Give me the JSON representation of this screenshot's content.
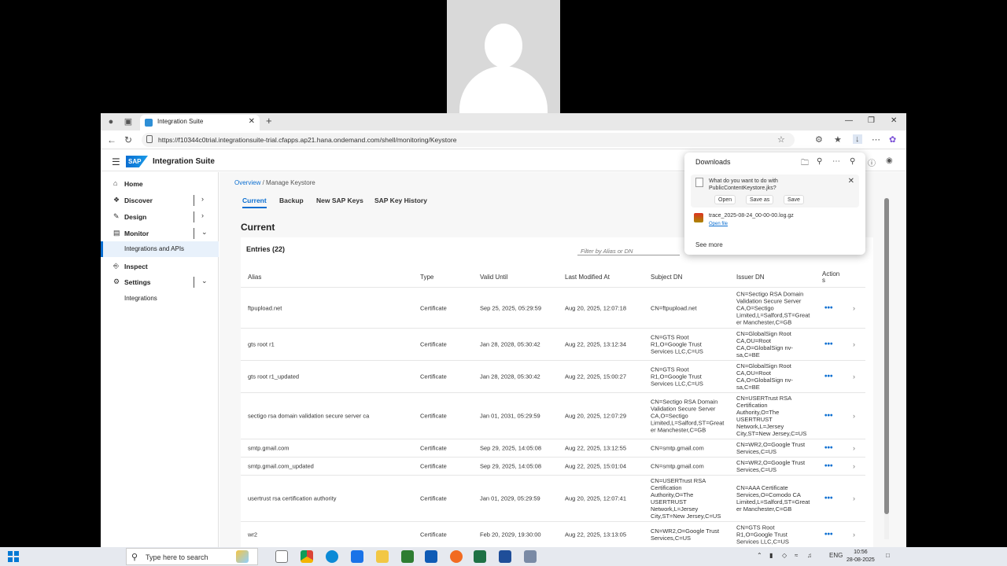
{
  "browser": {
    "tab_title": "Integration Suite",
    "url": "https://f10344c0trial.integrationsuite-trial.cfapps.ap21.hana.ondemand.com/shell/monitoring/Keystore"
  },
  "shell": {
    "logo": "SAP",
    "app_title": "Integration Suite"
  },
  "sidenav": {
    "items": [
      {
        "label": "Home"
      },
      {
        "label": "Discover"
      },
      {
        "label": "Design"
      },
      {
        "label": "Monitor"
      },
      {
        "label": "Integrations and APIs"
      },
      {
        "label": "Inspect"
      },
      {
        "label": "Settings"
      },
      {
        "label": "Integrations"
      }
    ]
  },
  "breadcrumb": {
    "overview": "Overview",
    "separator": "/",
    "current": "Manage Keystore"
  },
  "tabs": [
    "Current",
    "Backup",
    "New SAP Keys",
    "SAP Key History"
  ],
  "section_title": "Current",
  "entries_label": "Entries (22)",
  "filter_placeholder": "Filter by Alias or DN",
  "columns": [
    "Alias",
    "Type",
    "Valid Until",
    "Last Modified At",
    "Subject DN",
    "Issuer DN",
    "Action",
    "s"
  ],
  "rows": [
    {
      "alias": "ftpupload.net",
      "type": "Certificate",
      "valid": "Sep 25, 2025, 05:29:59",
      "modified": "Aug 20, 2025, 12:07:18",
      "subject": [
        "CN=ftpupload.net"
      ],
      "issuer": [
        "CN=Sectigo RSA Domain",
        "Validation Secure Server",
        "CA,O=Sectigo",
        "Limited,L=Salford,ST=Great",
        "er Manchester,C=GB"
      ]
    },
    {
      "alias": "gts root r1",
      "type": "Certificate",
      "valid": "Jan 28, 2028, 05:30:42",
      "modified": "Aug 22, 2025, 13:12:34",
      "subject": [
        "CN=GTS Root",
        "R1,O=Google Trust",
        "Services LLC,C=US"
      ],
      "issuer": [
        "CN=GlobalSign Root",
        "CA,OU=Root",
        "CA,O=GlobalSign nv-",
        "sa,C=BE"
      ]
    },
    {
      "alias": "gts root r1_updated",
      "type": "Certificate",
      "valid": "Jan 28, 2028, 05:30:42",
      "modified": "Aug 22, 2025, 15:00:27",
      "subject": [
        "CN=GTS Root",
        "R1,O=Google Trust",
        "Services LLC,C=US"
      ],
      "issuer": [
        "CN=GlobalSign Root",
        "CA,OU=Root",
        "CA,O=GlobalSign nv-",
        "sa,C=BE"
      ]
    },
    {
      "alias": "sectigo rsa domain validation secure server ca",
      "type": "Certificate",
      "valid": "Jan 01, 2031, 05:29:59",
      "modified": "Aug 20, 2025, 12:07:29",
      "subject": [
        "CN=Sectigo RSA Domain",
        "Validation Secure Server",
        "CA,O=Sectigo",
        "Limited,L=Salford,ST=Great",
        "er Manchester,C=GB"
      ],
      "issuer": [
        "CN=USERTrust RSA",
        "Certification",
        "Authority,O=The",
        "USERTRUST",
        "Network,L=Jersey",
        "City,ST=New Jersey,C=US"
      ]
    },
    {
      "alias": "smtp.gmail.com",
      "type": "Certificate",
      "valid": "Sep 29, 2025, 14:05:08",
      "modified": "Aug 22, 2025, 13:12:55",
      "subject": [
        "CN=smtp.gmail.com"
      ],
      "issuer": [
        "CN=WR2,O=Google Trust",
        "Services,C=US"
      ]
    },
    {
      "alias": "smtp.gmail.com_updated",
      "type": "Certificate",
      "valid": "Sep 29, 2025, 14:05:08",
      "modified": "Aug 22, 2025, 15:01:04",
      "subject": [
        "CN=smtp.gmail.com"
      ],
      "issuer": [
        "CN=WR2,O=Google Trust",
        "Services,C=US"
      ]
    },
    {
      "alias": "usertrust rsa certification authority",
      "type": "Certificate",
      "valid": "Jan 01, 2029, 05:29:59",
      "modified": "Aug 20, 2025, 12:07:41",
      "subject": [
        "CN=USERTrust RSA",
        "Certification",
        "Authority,O=The",
        "USERTRUST",
        "Network,L=Jersey",
        "City,ST=New Jersey,C=US"
      ],
      "issuer": [
        "CN=AAA Certificate",
        "Services,O=Comodo CA",
        "Limited,L=Salford,ST=Great",
        "er Manchester,C=GB"
      ]
    },
    {
      "alias": "wr2",
      "type": "Certificate",
      "valid": "Feb 20, 2029, 19:30:00",
      "modified": "Aug 22, 2025, 13:13:05",
      "subject": [
        "CN=WR2,O=Google Trust",
        "Services,C=US"
      ],
      "issuer": [
        "CN=GTS Root",
        "R1,O=Google Trust",
        "Services LLC,C=US"
      ]
    }
  ],
  "downloads": {
    "title": "Downloads",
    "question": "What do you want to do with PublicContentKeystore.jks?",
    "open": "Open",
    "save_as": "Save as",
    "save": "Save",
    "file2": "trace_2025-08-24_00-00-00.log.gz",
    "open_file": "Open file",
    "see_more": "See more"
  },
  "taskbar": {
    "search_placeholder": "Type here to search",
    "lang": "ENG",
    "time": "10:56",
    "date": "28-08-2025"
  },
  "colors": {
    "accent": "#0a6ed1",
    "sap_blue": "#1a9be8"
  }
}
